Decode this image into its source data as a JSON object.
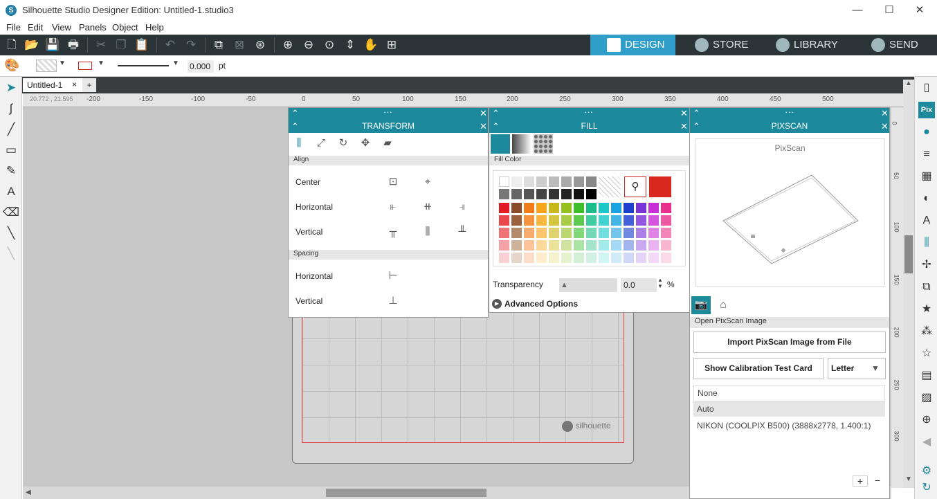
{
  "window": {
    "title": "Silhouette Studio Designer Edition: Untitled-1.studio3",
    "minimize": "—",
    "maximize": "☐",
    "close": "✕"
  },
  "menu": [
    "File",
    "Edit",
    "View",
    "Panels",
    "Object",
    "Help"
  ],
  "nav": {
    "design": "DESIGN",
    "store": "STORE",
    "library": "LIBRARY",
    "send": "SEND"
  },
  "props": {
    "line_width": "0.000",
    "unit": "pt"
  },
  "doc": {
    "tab": "Untitled-1",
    "close": "×",
    "add": "+"
  },
  "ruler": {
    "coords": "20.772 , 21.595",
    "ticks": [
      "-200",
      "-150",
      "-100",
      "-50",
      "0",
      "50",
      "100",
      "150",
      "200",
      "250",
      "300",
      "350",
      "400",
      "450",
      "500"
    ],
    "vticks": [
      "0",
      "50",
      "100",
      "150",
      "200",
      "250",
      "300"
    ]
  },
  "mat": {
    "brand": "silhouette"
  },
  "transform": {
    "title": "TRANSFORM",
    "align_section": "Align",
    "rows": [
      "Center",
      "Horizontal",
      "Vertical"
    ],
    "spacing_section": "Spacing",
    "spacing_rows": [
      "Horizontal",
      "Vertical"
    ]
  },
  "fill": {
    "title": "FILL",
    "section": "Fill Color",
    "transparency_label": "Transparency",
    "transparency_value": "0.0",
    "transparency_unit": "%",
    "advanced": "Advanced Options",
    "selected_color": "#d9281e",
    "palette": [
      [
        "#ffffff",
        "#eeeeee",
        "#dddddd",
        "#cccccc",
        "#bbbbbb",
        "#aaaaaa",
        "#999999",
        "#888888"
      ],
      [
        "#777777",
        "#666666",
        "#555555",
        "#444444",
        "#333333",
        "#222222",
        "#111111",
        "#000000"
      ],
      [
        "#e31b23",
        "#8a4b2a",
        "#f07d1a",
        "#f7a51b",
        "#c9b81c",
        "#97bf1f",
        "#3dbe2a",
        "#1cbd8a",
        "#1cc6c6",
        "#1aa3e0",
        "#1f3fd0",
        "#7a35d6",
        "#c92fd6",
        "#e8318c"
      ],
      [
        "#e8474c",
        "#9a5f3d",
        "#f4943e",
        "#f9b640",
        "#d5c63f",
        "#a8cc43",
        "#5ccb4d",
        "#43cc9f",
        "#43d2d2",
        "#43b4e6",
        "#4360da",
        "#9257de",
        "#d456de",
        "#ee58a2"
      ],
      [
        "#ee7377",
        "#b38a6a",
        "#f7ab6a",
        "#fbc66b",
        "#dfd56c",
        "#bbd870",
        "#82d778",
        "#72d8b5",
        "#72dede",
        "#72c6ec",
        "#7289e4",
        "#ac7ee7",
        "#df83e7",
        "#f386b8"
      ],
      [
        "#f4a2a5",
        "#cdb39b",
        "#fac39a",
        "#fcd89b",
        "#e9e39c",
        "#d0e4a0",
        "#abe3a6",
        "#a3e4cb",
        "#a3eaea",
        "#a3d9f2",
        "#a3b3ee",
        "#c9aaf0",
        "#eab2f0",
        "#f8b6d0"
      ],
      [
        "#f9d0d2",
        "#e5d6c9",
        "#fcddc9",
        "#feecca",
        "#f4f2cb",
        "#e6f1cd",
        "#d4f0d4",
        "#d1f1e5",
        "#d1f4f4",
        "#d1ebf8",
        "#d1d8f6",
        "#e3d4f8",
        "#f4d8f7",
        "#fbdbe8"
      ]
    ]
  },
  "pixscan": {
    "title": "PIXSCAN",
    "preview_label": "PixScan",
    "section": "Open PixScan Image",
    "import_btn": "Import PixScan Image from File",
    "calib_btn": "Show Calibration Test Card",
    "paper": "Letter",
    "list": [
      "None",
      "Auto",
      "NIKON (COOLPIX B500) (3888x2778, 1.400:1)"
    ],
    "add": "+",
    "remove": "−"
  }
}
